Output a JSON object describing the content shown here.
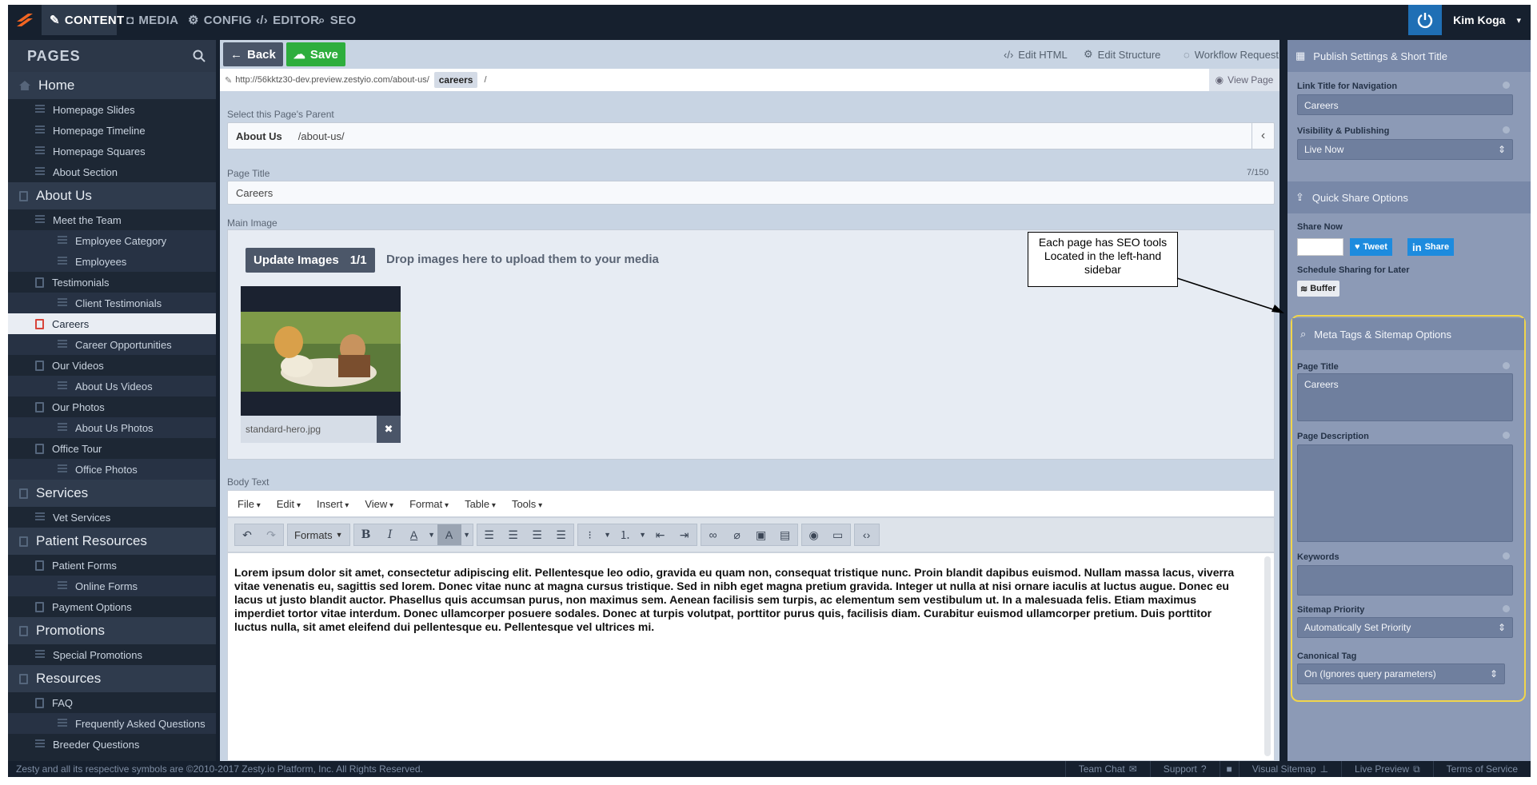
{
  "topnav": {
    "items": [
      {
        "label": "CONTENT",
        "icon": "edit-icon"
      },
      {
        "label": "MEDIA",
        "icon": "camera-icon"
      },
      {
        "label": "CONFIG",
        "icon": "gears-icon"
      },
      {
        "label": "EDITOR",
        "icon": "code-icon"
      },
      {
        "label": "SEO",
        "icon": "search-icon"
      }
    ],
    "user": "Kim Koga"
  },
  "sidebar": {
    "title": "PAGES",
    "items": [
      {
        "label": "Home",
        "level": 0,
        "icon": "home"
      },
      {
        "label": "Homepage Slides",
        "level": 1,
        "icon": "list"
      },
      {
        "label": "Homepage Timeline",
        "level": 1,
        "icon": "list"
      },
      {
        "label": "Homepage Squares",
        "level": 1,
        "icon": "list"
      },
      {
        "label": "About Section",
        "level": 1,
        "icon": "list"
      },
      {
        "label": "About Us",
        "level": 0,
        "icon": "page"
      },
      {
        "label": "Meet the Team",
        "level": 1,
        "icon": "list"
      },
      {
        "label": "Employee Category",
        "level": 2,
        "icon": "list"
      },
      {
        "label": "Employees",
        "level": 2,
        "icon": "list"
      },
      {
        "label": "Testimonials",
        "level": 1,
        "icon": "page"
      },
      {
        "label": "Client Testimonials",
        "level": 2,
        "icon": "list"
      },
      {
        "label": "Careers",
        "level": 1,
        "icon": "page",
        "selected": true
      },
      {
        "label": "Career Opportunities",
        "level": 2,
        "icon": "list"
      },
      {
        "label": "Our Videos",
        "level": 1,
        "icon": "page"
      },
      {
        "label": "About Us Videos",
        "level": 2,
        "icon": "list"
      },
      {
        "label": "Our Photos",
        "level": 1,
        "icon": "page"
      },
      {
        "label": "About Us Photos",
        "level": 2,
        "icon": "list"
      },
      {
        "label": "Office Tour",
        "level": 1,
        "icon": "page"
      },
      {
        "label": "Office Photos",
        "level": 2,
        "icon": "list"
      },
      {
        "label": "Services",
        "level": 0,
        "icon": "page"
      },
      {
        "label": "Vet Services",
        "level": 1,
        "icon": "list"
      },
      {
        "label": "Patient Resources",
        "level": 0,
        "icon": "page"
      },
      {
        "label": "Patient Forms",
        "level": 1,
        "icon": "page"
      },
      {
        "label": "Online Forms",
        "level": 2,
        "icon": "list"
      },
      {
        "label": "Payment Options",
        "level": 1,
        "icon": "page"
      },
      {
        "label": "Promotions",
        "level": 0,
        "icon": "page"
      },
      {
        "label": "Special Promotions",
        "level": 1,
        "icon": "list"
      },
      {
        "label": "Resources",
        "level": 0,
        "icon": "page"
      },
      {
        "label": "FAQ",
        "level": 1,
        "icon": "page"
      },
      {
        "label": "Frequently Asked Questions",
        "level": 2,
        "icon": "list"
      },
      {
        "label": "Breeder Questions",
        "level": 1,
        "icon": "list"
      }
    ]
  },
  "toolbar": {
    "back_label": "Back",
    "save_label": "Save",
    "edit_html": "Edit HTML",
    "edit_structure": "Edit Structure",
    "workflow": "Workflow Request"
  },
  "url": {
    "base": "http://56kktz30-dev.preview.zestyio.com/about-us/",
    "slug": "careers",
    "trail": "/",
    "view_page": "View Page"
  },
  "form": {
    "parent_label": "Select this Page's Parent",
    "parent_name": "About Us",
    "parent_path": "/about-us/",
    "title_label": "Page Title",
    "title_count": "7/150",
    "title_value": "Careers",
    "image_label": "Main Image",
    "update_images": "Update Images",
    "image_count": "1/1",
    "drop_text": "Drop images here to upload them to your media",
    "image_filename": "standard-hero.jpg",
    "body_label": "Body Text"
  },
  "callout": "Each page has SEO tools Located in the left-hand sidebar",
  "editor": {
    "menus": [
      "File",
      "Edit",
      "Insert",
      "View",
      "Format",
      "Table",
      "Tools"
    ],
    "formats_label": "Formats",
    "body": "Lorem ipsum dolor sit amet, consectetur adipiscing elit. Pellentesque leo odio, gravida eu quam non, consequat tristique nunc. Proin blandit dapibus euismod. Nullam massa lacus, viverra vitae venenatis eu, sagittis sed lorem. Donec vitae nunc at magna cursus tristique. Sed in nibh eget magna pretium gravida. Integer ut nulla at nisi ornare iaculis at luctus augue. Donec eu lacus ut justo blandit auctor. Phasellus quis accumsan purus, non maximus sem. Aenean facilisis sem turpis, ac elementum sem vestibulum ut. In a malesuada felis. Etiam maximus imperdiet tortor vitae interdum. Donec ullamcorper posuere sodales. Donec at turpis volutpat, porttitor purus quis, facilisis diam. Curabitur euismod ullamcorper pretium. Duis porttitor luctus nulla, sit amet eleifend dui pellentesque eu. Pellentesque vel ultrices mi."
  },
  "right": {
    "publish_head": "Publish Settings & Short Title",
    "link_title_label": "Link Title for Navigation",
    "link_title_value": "Careers",
    "visibility_label": "Visibility & Publishing",
    "visibility_value": "Live Now",
    "share_head": "Quick Share Options",
    "share_now": "Share Now",
    "tweet": "Tweet",
    "share": "Share",
    "schedule": "Schedule Sharing for Later",
    "buffer": "Buffer",
    "meta_head": "Meta Tags & Sitemap Options",
    "page_title_label": "Page Title",
    "page_title_value": "Careers",
    "desc_label": "Page Description",
    "keywords_label": "Keywords",
    "priority_label": "Sitemap Priority",
    "priority_value": "Automatically Set Priority",
    "canonical_label": "Canonical Tag",
    "canonical_value": "On (Ignores query parameters)"
  },
  "footer": {
    "copyright": "Zesty and all its respective symbols are ©2010-2017 Zesty.io Platform, Inc. All Rights Reserved.",
    "links": [
      "Team Chat",
      "Support",
      "Visual Sitemap",
      "Live Preview",
      "Terms of Service"
    ]
  },
  "colors": {
    "accent": "#f26522",
    "save": "#2eae3d",
    "highlight": "#f1d54b",
    "twitter": "#1d8bde"
  }
}
